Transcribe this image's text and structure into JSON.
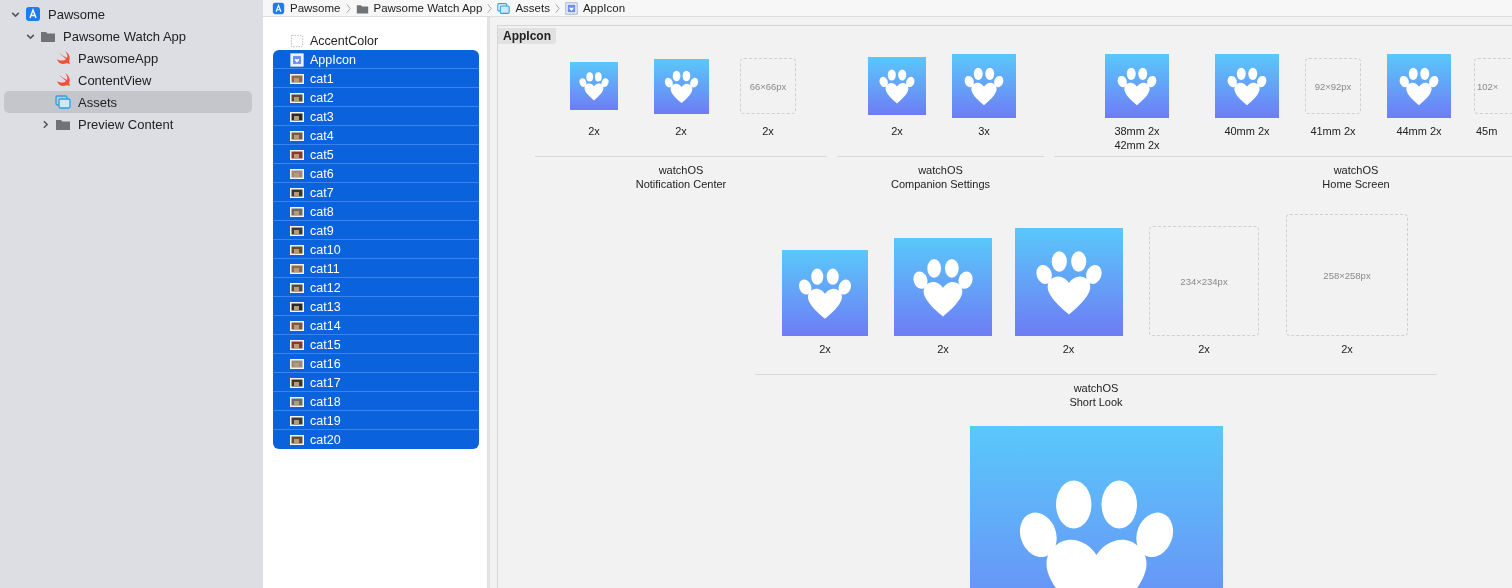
{
  "navigator": {
    "items": [
      {
        "label": "Pawsome",
        "kind": "project",
        "expanded": true,
        "selected": false,
        "children": [
          {
            "label": "Pawsome Watch App",
            "kind": "folder",
            "expanded": true,
            "selected": false,
            "children": [
              {
                "label": "PawsomeApp",
                "kind": "swift",
                "selected": false
              },
              {
                "label": "ContentView",
                "kind": "swift",
                "selected": false
              },
              {
                "label": "Assets",
                "kind": "assets",
                "selected": true
              },
              {
                "label": "Preview Content",
                "kind": "folder",
                "expanded": false,
                "selected": false
              }
            ]
          }
        ]
      }
    ]
  },
  "breadcrumb": [
    {
      "label": "Pawsome",
      "kind": "project"
    },
    {
      "label": "Pawsome Watch App",
      "kind": "folder"
    },
    {
      "label": "Assets",
      "kind": "assets"
    },
    {
      "label": "AppIcon",
      "kind": "appicon"
    }
  ],
  "assets": [
    {
      "label": "AccentColor",
      "kind": "color",
      "selected": false
    },
    {
      "label": "AppIcon",
      "kind": "appicon",
      "selected": true
    },
    {
      "label": "cat1",
      "kind": "image",
      "selected": true
    },
    {
      "label": "cat2",
      "kind": "image",
      "selected": true
    },
    {
      "label": "cat3",
      "kind": "image",
      "selected": true
    },
    {
      "label": "cat4",
      "kind": "image",
      "selected": true
    },
    {
      "label": "cat5",
      "kind": "image",
      "selected": true
    },
    {
      "label": "cat6",
      "kind": "image",
      "selected": true
    },
    {
      "label": "cat7",
      "kind": "image",
      "selected": true
    },
    {
      "label": "cat8",
      "kind": "image",
      "selected": true
    },
    {
      "label": "cat9",
      "kind": "image",
      "selected": true
    },
    {
      "label": "cat10",
      "kind": "image",
      "selected": true
    },
    {
      "label": "cat11",
      "kind": "image",
      "selected": true
    },
    {
      "label": "cat12",
      "kind": "image",
      "selected": true
    },
    {
      "label": "cat13",
      "kind": "image",
      "selected": true
    },
    {
      "label": "cat14",
      "kind": "image",
      "selected": true
    },
    {
      "label": "cat15",
      "kind": "image",
      "selected": true
    },
    {
      "label": "cat16",
      "kind": "image",
      "selected": true
    },
    {
      "label": "cat17",
      "kind": "image",
      "selected": true
    },
    {
      "label": "cat18",
      "kind": "image",
      "selected": true
    },
    {
      "label": "cat19",
      "kind": "image",
      "selected": true
    },
    {
      "label": "cat20",
      "kind": "image",
      "selected": true
    }
  ],
  "editor": {
    "title": "AppIcon",
    "rows": [
      {
        "groups": [
          {
            "platform": "watchOS",
            "name": "Notification Center",
            "slots": [
              {
                "kind": "icon",
                "scales": [
                  "2x"
                ]
              },
              {
                "kind": "icon",
                "scales": [
                  "2x"
                ]
              },
              {
                "kind": "empty",
                "size": "66×66px",
                "scales": [
                  "2x"
                ]
              }
            ]
          },
          {
            "platform": "watchOS",
            "name": "Companion Settings",
            "slots": [
              {
                "kind": "icon",
                "scales": [
                  "2x"
                ]
              },
              {
                "kind": "icon",
                "scales": [
                  "3x"
                ]
              }
            ]
          },
          {
            "platform": "watchOS",
            "name": "Home Screen",
            "slots": [
              {
                "kind": "icon",
                "scales": [
                  "38mm 2x",
                  "42mm 2x"
                ]
              },
              {
                "kind": "icon",
                "scales": [
                  "40mm 2x"
                ]
              },
              {
                "kind": "empty",
                "size": "92×92px",
                "scales": [
                  "41mm 2x"
                ]
              },
              {
                "kind": "icon",
                "scales": [
                  "44mm 2x"
                ]
              },
              {
                "kind": "empty",
                "size": "102×",
                "scales": [
                  "45m"
                ]
              }
            ]
          }
        ]
      },
      {
        "groups": [
          {
            "platform": "watchOS",
            "name": "Short Look",
            "slots": [
              {
                "kind": "icon",
                "scales": [
                  "2x"
                ]
              },
              {
                "kind": "icon",
                "scales": [
                  "2x"
                ]
              },
              {
                "kind": "icon",
                "scales": [
                  "2x"
                ]
              },
              {
                "kind": "empty",
                "size": "234×234px",
                "scales": [
                  "2x"
                ]
              },
              {
                "kind": "empty",
                "size": "258×258px",
                "scales": [
                  "2x"
                ]
              }
            ]
          }
        ]
      },
      {
        "groups": [
          {
            "slots": [
              {
                "kind": "icon"
              }
            ]
          }
        ]
      }
    ]
  }
}
